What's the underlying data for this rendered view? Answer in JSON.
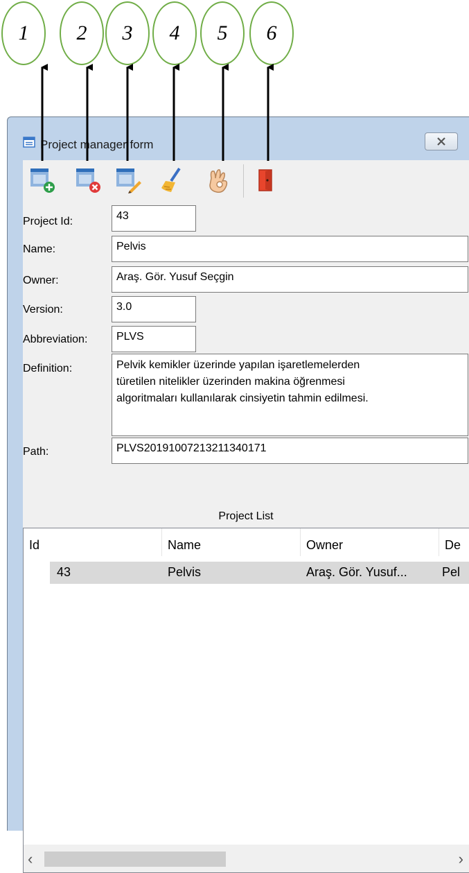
{
  "callouts": [
    "1",
    "2",
    "3",
    "4",
    "5",
    "6"
  ],
  "window": {
    "title": "Project manager form",
    "toolbar": {
      "icons": [
        "add-project-icon",
        "delete-project-icon",
        "edit-project-icon",
        "clear-broom-icon",
        "ok-hand-icon",
        "exit-door-icon"
      ]
    }
  },
  "form": {
    "project_id": {
      "label": "Project Id:",
      "value": "43"
    },
    "name": {
      "label": "Name:",
      "value": "Pelvis"
    },
    "owner": {
      "label": "Owner:",
      "value": "Araş. Gör. Yusuf Seçgin"
    },
    "version": {
      "label": "Version:",
      "value": "3.0"
    },
    "abbreviation": {
      "label": "Abbreviation:",
      "value": "PLVS"
    },
    "definition": {
      "label": "Definition:",
      "lines": [
        "Pelvik kemikler üzerinde yapılan işaretlemelerden",
        "türetilen nitelikler üzerinden makina öğrenmesi",
        "algoritmaları kullanılarak cinsiyetin tahmin edilmesi."
      ]
    },
    "path": {
      "label": "Path:",
      "value": "PLVS20191007213211340171"
    }
  },
  "project_list": {
    "caption": "Project List",
    "columns": [
      "Id",
      "Name",
      "Owner",
      "De"
    ],
    "rows": [
      {
        "id": "43",
        "name": "Pelvis",
        "owner": "Araş. Gör. Yusuf...",
        "definition": "Pel"
      }
    ]
  },
  "colors": {
    "callout_border": "#70ad47",
    "window_frame": "#bfd3ea",
    "client_bg": "#f0f0f0",
    "selected_row": "#d9d9d9"
  }
}
